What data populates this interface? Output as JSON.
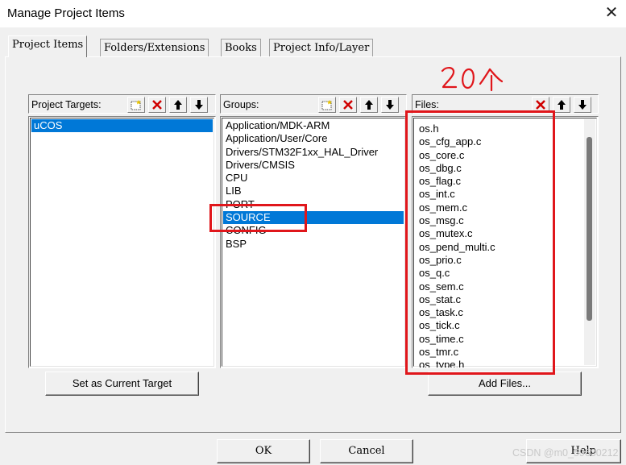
{
  "window": {
    "title": "Manage Project Items",
    "close_glyph": "✕"
  },
  "tabs": [
    {
      "label": "Project Items",
      "active": true
    },
    {
      "label": "Folders/Extensions",
      "active": false
    },
    {
      "label": "Books",
      "active": false
    },
    {
      "label": "Project Info/Layer",
      "active": false
    }
  ],
  "targets": {
    "caption": "Project Targets:",
    "tools": [
      "new-icon",
      "delete-icon",
      "move-up-icon",
      "move-down-icon"
    ],
    "items": [
      {
        "label": "uCOS",
        "selected": true
      }
    ]
  },
  "groups": {
    "caption": "Groups:",
    "tools": [
      "new-icon",
      "delete-icon",
      "move-up-icon",
      "move-down-icon"
    ],
    "items": [
      {
        "label": "Application/MDK-ARM",
        "selected": false
      },
      {
        "label": "Application/User/Core",
        "selected": false
      },
      {
        "label": "Drivers/STM32F1xx_HAL_Driver",
        "selected": false
      },
      {
        "label": "Drivers/CMSIS",
        "selected": false
      },
      {
        "label": "CPU",
        "selected": false
      },
      {
        "label": "LIB",
        "selected": false
      },
      {
        "label": "PORT",
        "selected": false
      },
      {
        "label": "SOURCE",
        "selected": true
      },
      {
        "label": "CONFIG",
        "selected": false
      },
      {
        "label": "BSP",
        "selected": false
      }
    ]
  },
  "files": {
    "caption": "Files:",
    "tools": [
      "delete-icon",
      "move-up-icon",
      "move-down-icon"
    ],
    "items": [
      {
        "label": "os.h"
      },
      {
        "label": "os_cfg_app.c"
      },
      {
        "label": "os_core.c"
      },
      {
        "label": "os_dbg.c"
      },
      {
        "label": "os_flag.c"
      },
      {
        "label": "os_int.c"
      },
      {
        "label": "os_mem.c"
      },
      {
        "label": "os_msg.c"
      },
      {
        "label": "os_mutex.c"
      },
      {
        "label": "os_pend_multi.c"
      },
      {
        "label": "os_prio.c"
      },
      {
        "label": "os_q.c"
      },
      {
        "label": "os_sem.c"
      },
      {
        "label": "os_stat.c"
      },
      {
        "label": "os_task.c"
      },
      {
        "label": "os_tick.c"
      },
      {
        "label": "os_time.c"
      },
      {
        "label": "os_tmr.c"
      },
      {
        "label": "os_type.h"
      }
    ]
  },
  "buttons": {
    "set_current_target": "Set as Current Target",
    "add_files": "Add Files...",
    "ok": "OK",
    "cancel": "Cancel",
    "help": "Help"
  },
  "annotation": {
    "handwritten_text": "20个",
    "color": "#e0161b"
  },
  "watermark": "CSDN @m0_59630212",
  "colors": {
    "selection": "#0078d7",
    "dialog_bg": "#f0f0f0",
    "annotation_red": "#e0161b"
  }
}
